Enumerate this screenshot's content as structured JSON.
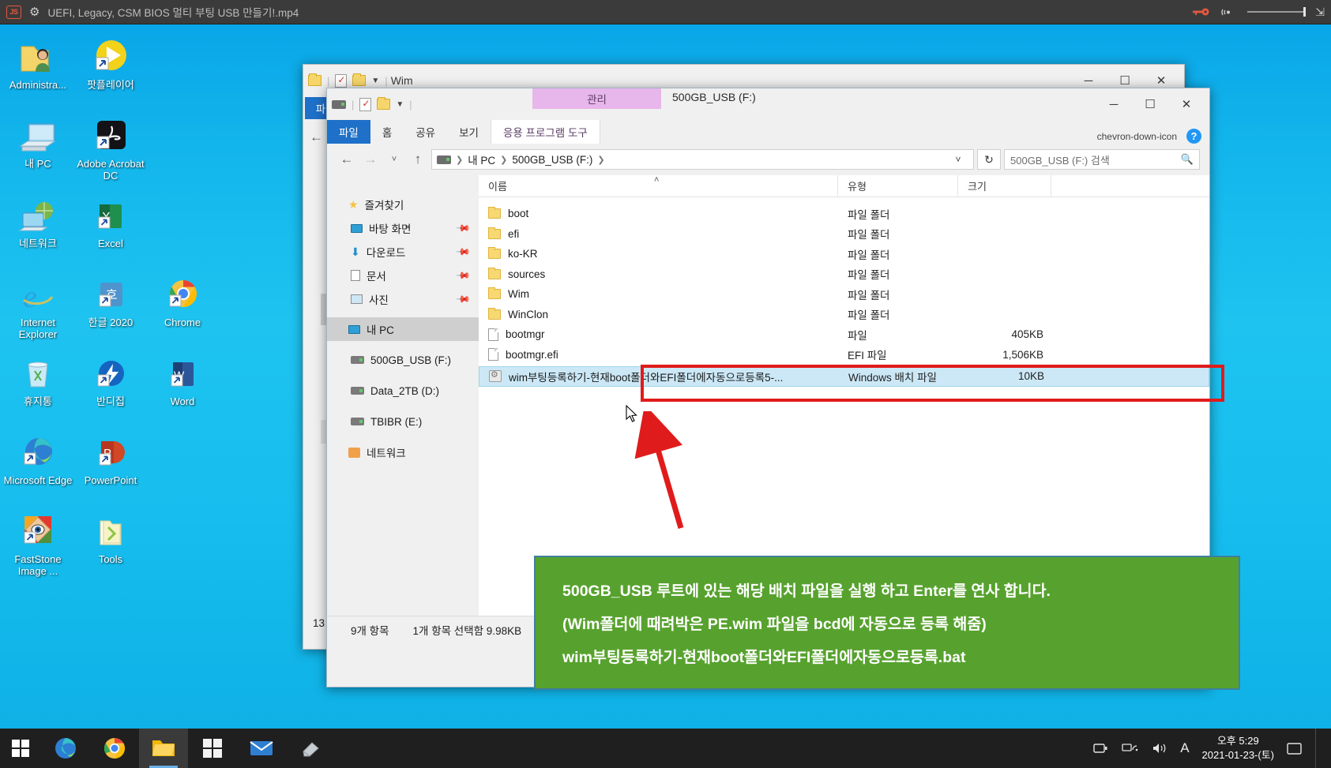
{
  "player": {
    "logo_text": "JS",
    "gear_icon": "gear-icon",
    "title": "UEFI, Legacy, CSM BIOS  멀티 부팅 USB 만들기!.mp4",
    "key_icon": "key-icon",
    "cast_icon": "cast-icon",
    "expand_icon": "expand-icon"
  },
  "desktop": {
    "icons": [
      {
        "label": "Administra...",
        "icon": "user-folder-icon",
        "shortcut": false
      },
      {
        "label": "팟플레이어",
        "icon": "potplayer-icon",
        "shortcut": true
      },
      {
        "label": "내 PC",
        "icon": "this-pc-icon",
        "shortcut": false
      },
      {
        "label": "Adobe Acrobat DC",
        "icon": "acrobat-icon",
        "shortcut": true
      },
      {
        "label": "네트워크",
        "icon": "network-icon",
        "shortcut": false
      },
      {
        "label": "Excel",
        "icon": "excel-icon",
        "shortcut": true
      },
      {
        "label": "Internet Explorer",
        "icon": "internet-explorer-icon",
        "shortcut": false
      },
      {
        "label": "한글 2020",
        "icon": "hangul-icon",
        "shortcut": true
      },
      {
        "label": "Chrome",
        "icon": "chrome-icon",
        "shortcut": true
      },
      {
        "label": "휴지통",
        "icon": "recycle-bin-icon",
        "shortcut": false
      },
      {
        "label": "반디집",
        "icon": "bandizip-icon",
        "shortcut": true
      },
      {
        "label": "Word",
        "icon": "word-icon",
        "shortcut": true
      },
      {
        "label": "Microsoft Edge",
        "icon": "edge-icon",
        "shortcut": true
      },
      {
        "label": "PowerPoint",
        "icon": "powerpoint-icon",
        "shortcut": true
      },
      {
        "label": "FastStone Image ...",
        "icon": "faststone-icon",
        "shortcut": true
      },
      {
        "label": "Tools",
        "icon": "folder-icon",
        "shortcut": false
      }
    ]
  },
  "back_window": {
    "title": "Wim",
    "tab_file": "파",
    "minimize": "─",
    "maximize": "☐",
    "close": "✕",
    "item_count": "13"
  },
  "explorer": {
    "title": "500GB_USB (F:)",
    "context_tab_header": "관리",
    "context_tab_label": "응용 프로그램 도구",
    "tabs": [
      {
        "label": "파일",
        "active": true
      },
      {
        "label": "홈",
        "active": false
      },
      {
        "label": "공유",
        "active": false
      },
      {
        "label": "보기",
        "active": false
      }
    ],
    "help_icon": "help-icon",
    "ribbon_collapse_icon": "chevron-down-icon",
    "window_controls": {
      "minimize": "─",
      "maximize": "☐",
      "close": "✕"
    },
    "nav": {
      "back_icon": "←",
      "forward_icon": "→",
      "recent_icon": "˅",
      "up_icon": "↑",
      "refresh_icon": "↻",
      "dropdown_icon": "˅"
    },
    "breadcrumb": [
      "내 PC",
      "500GB_USB (F:)"
    ],
    "search_placeholder": "500GB_USB (F:) 검색",
    "search_icon": "magnifier-icon",
    "sidebar": [
      {
        "label": "즐겨찾기",
        "icon": "star-icon",
        "pinned": false,
        "selected": false,
        "indent": 0
      },
      {
        "label": "바탕 화면",
        "icon": "desktop-icon",
        "pinned": true,
        "selected": false,
        "indent": 1
      },
      {
        "label": "다운로드",
        "icon": "download-icon",
        "pinned": true,
        "selected": false,
        "indent": 1
      },
      {
        "label": "문서",
        "icon": "documents-icon",
        "pinned": true,
        "selected": false,
        "indent": 1
      },
      {
        "label": "사진",
        "icon": "pictures-icon",
        "pinned": true,
        "selected": false,
        "indent": 1
      },
      {
        "label": "내 PC",
        "icon": "this-pc-icon",
        "pinned": false,
        "selected": true,
        "indent": 0
      },
      {
        "label": "500GB_USB (F:)",
        "icon": "drive-icon",
        "pinned": false,
        "selected": false,
        "indent": 1
      },
      {
        "label": "Data_2TB (D:)",
        "icon": "drive-icon",
        "pinned": false,
        "selected": false,
        "indent": 1
      },
      {
        "label": "TBIBR (E:)",
        "icon": "drive-icon",
        "pinned": false,
        "selected": false,
        "indent": 1
      },
      {
        "label": "네트워크",
        "icon": "network-icon",
        "pinned": false,
        "selected": false,
        "indent": 0
      }
    ],
    "columns": {
      "name": "이름",
      "type": "유형",
      "size": "크기",
      "sort_caret": "˄"
    },
    "rows": [
      {
        "name": "boot",
        "type": "파일 폴더",
        "size": "",
        "icon": "folder-icon",
        "selected": false
      },
      {
        "name": "efi",
        "type": "파일 폴더",
        "size": "",
        "icon": "folder-icon",
        "selected": false
      },
      {
        "name": "ko-KR",
        "type": "파일 폴더",
        "size": "",
        "icon": "folder-icon",
        "selected": false
      },
      {
        "name": "sources",
        "type": "파일 폴더",
        "size": "",
        "icon": "folder-icon",
        "selected": false
      },
      {
        "name": "Wim",
        "type": "파일 폴더",
        "size": "",
        "icon": "folder-icon",
        "selected": false
      },
      {
        "name": "WinClon",
        "type": "파일 폴더",
        "size": "",
        "icon": "folder-icon",
        "selected": false
      },
      {
        "name": "bootmgr",
        "type": "파일",
        "size": "405KB",
        "icon": "file-icon",
        "selected": false
      },
      {
        "name": "bootmgr.efi",
        "type": "EFI 파일",
        "size": "1,506KB",
        "icon": "file-icon",
        "selected": false
      },
      {
        "name": "wim부팅등록하기-현재boot폴더와EFI폴더에자동으로등록5-...",
        "type": "Windows 배치 파일",
        "size": "10KB",
        "icon": "batch-file-icon",
        "selected": true
      }
    ],
    "status": {
      "items": "9개 항목",
      "selection": "1개 항목 선택함 9.98KB"
    }
  },
  "callout": {
    "lines": [
      "500GB_USB 루트에 있는 해당 배치 파일을 실행 하고 Enter를 연사 합니다.",
      "(Wim폴더에 때려박은 PE.wim 파일을 bcd에 자동으로 등록 해줌)",
      "wim부팅등록하기-현재boot폴더와EFI폴더에자동으로등록.bat"
    ],
    "bg_color": "#57a22e",
    "border_color": "#3f7f9e",
    "arrow_color": "#e01b1b"
  },
  "taskbar": {
    "start_icon": "windows-start-icon",
    "items": [
      {
        "icon": "edge-icon",
        "active": false
      },
      {
        "icon": "chrome-icon",
        "active": false
      },
      {
        "icon": "file-explorer-icon",
        "active": true
      },
      {
        "icon": "store-icon",
        "active": false
      },
      {
        "icon": "mail-icon",
        "active": false
      },
      {
        "icon": "eraser-icon",
        "active": false
      }
    ],
    "tray": [
      {
        "icon": "battery-icon"
      },
      {
        "icon": "network-tray-icon"
      },
      {
        "icon": "volume-icon"
      },
      {
        "icon": "ime-icon",
        "label": "A"
      }
    ],
    "clock_time": "오후 5:29",
    "clock_date": "2021-01-23-(토)",
    "show_desktop": "show-desktop-button"
  }
}
